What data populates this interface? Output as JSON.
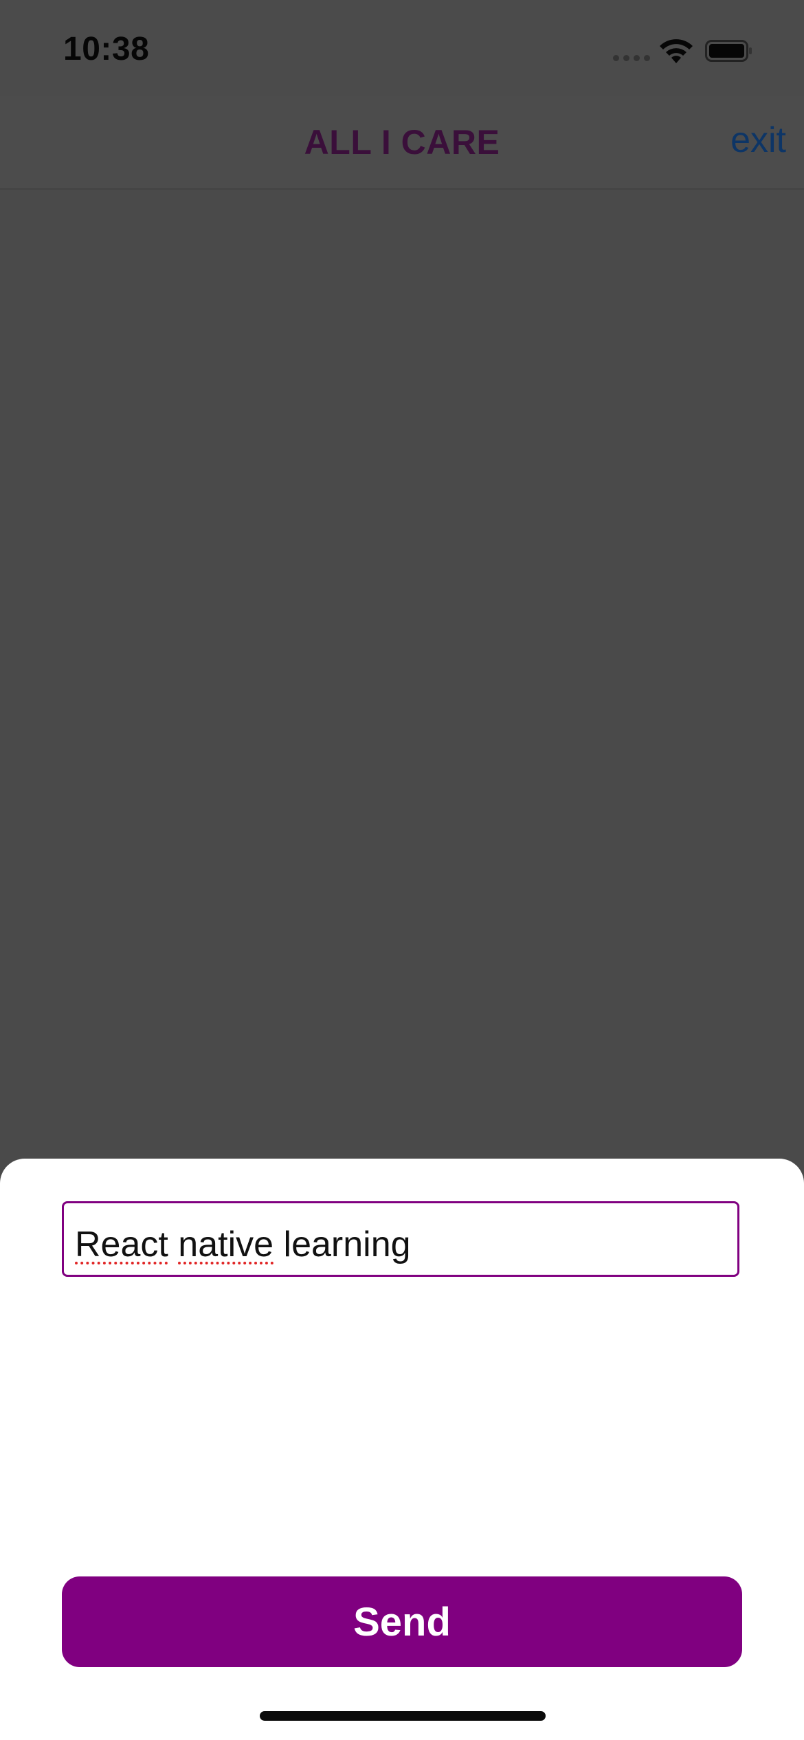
{
  "status_bar": {
    "time": "10:38",
    "icons": [
      "cellular-signal-icon",
      "wifi-icon",
      "battery-icon"
    ]
  },
  "nav": {
    "title": "ALL I CARE",
    "exit_label": "exit"
  },
  "sheet": {
    "input_value_words": [
      "React",
      "native",
      "learning"
    ],
    "input_value": "React native learning",
    "send_label": "Send"
  },
  "colors": {
    "accent": "#800080",
    "nav_title": "#3a0f3a",
    "exit_link": "#0d3566",
    "overlay": "#4a4a4a",
    "spellcheck_underline": "#e02424"
  }
}
